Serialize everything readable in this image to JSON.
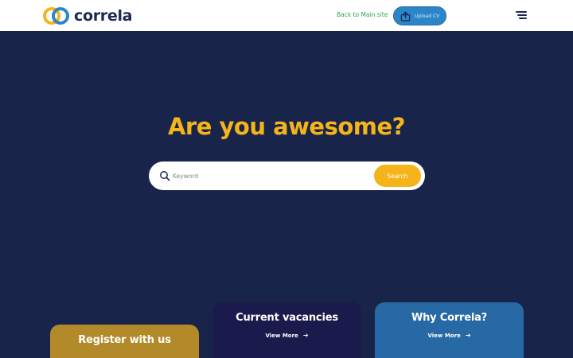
{
  "header": {
    "logo_text": "correla",
    "logo_icon": "interlocking-rings-logo",
    "back_link": "Back to Main site",
    "upload_label": "Upload CV",
    "upload_icon": "upload-icon",
    "menu_icon": "hamburger-menu-icon"
  },
  "hero": {
    "title": "Are you awesome?"
  },
  "search": {
    "placeholder": "Keyword",
    "button_label": "Search",
    "icon": "search-icon"
  },
  "cards": [
    {
      "title": "Register with us",
      "link": ""
    },
    {
      "title": "Current vacancies",
      "link": "View More"
    },
    {
      "title": "Why Correla?",
      "link": "View More"
    }
  ],
  "colors": {
    "background": "#18244a",
    "accent_yellow": "#f4b41a",
    "accent_blue": "#2a86c8",
    "link_green": "#2ba84a",
    "card_register": "#b38a2a",
    "card_vacancies": "#1b1a4c",
    "card_why": "#2669a4"
  }
}
